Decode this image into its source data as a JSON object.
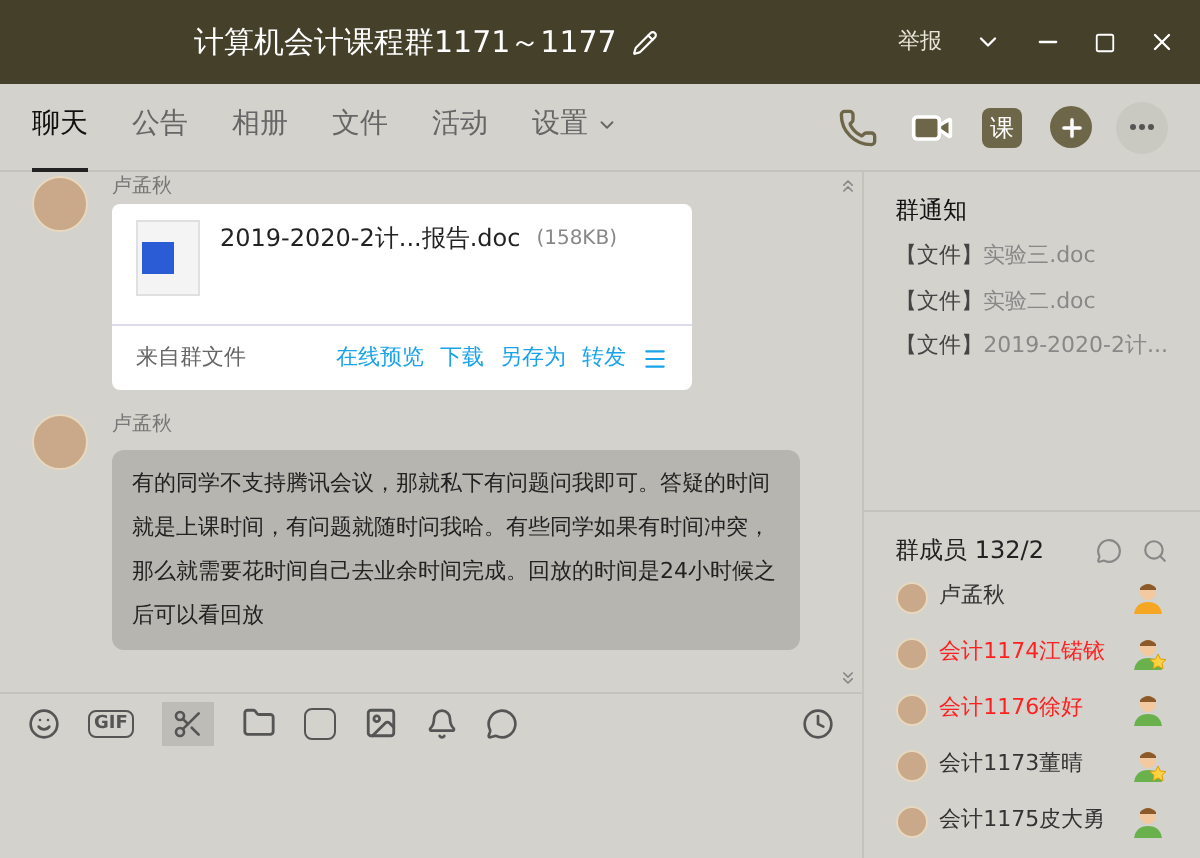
{
  "window": {
    "title": "计算机会计课程群1171～1177",
    "report": "举报",
    "class_button": "课"
  },
  "toolbar": {
    "gif_label": "GIF"
  },
  "tabs": [
    {
      "label": "聊天",
      "selected": true
    },
    {
      "label": "公告",
      "selected": false
    },
    {
      "label": "相册",
      "selected": false
    },
    {
      "label": "文件",
      "selected": false
    },
    {
      "label": "活动",
      "selected": false
    },
    {
      "label": "设置",
      "selected": false
    }
  ],
  "messages": [
    {
      "kind": "file",
      "sender": "卢孟秋",
      "file_name": "2019-2020-2计...报告.doc",
      "file_size": "(158KB)",
      "source": "来自群文件",
      "actions": [
        "在线预览",
        "下载",
        "另存为",
        "转发"
      ]
    },
    {
      "kind": "text",
      "sender": "卢孟秋",
      "text": "有的同学不支持腾讯会议，那就私下有问题问我即可。答疑的时间就是上课时间，有问题就随时问我哈。有些同学如果有时间冲突，那么就需要花时间自己去业余时间完成。回放的时间是24小时候之后可以看回放"
    }
  ],
  "notice": {
    "title": "群通知",
    "items": [
      {
        "tag": "【文件】",
        "name": "实验三.doc"
      },
      {
        "tag": "【文件】",
        "name": "实验二.doc"
      },
      {
        "tag": "【文件】",
        "name": "2019-2020-2计..."
      }
    ]
  },
  "members": {
    "title": "群成员 132/2",
    "items": [
      {
        "name": "卢孟秋",
        "color": "#333333",
        "kind": "owner"
      },
      {
        "name": "会计1174江锘铱",
        "color": "#ff2020",
        "kind": "admin"
      },
      {
        "name": "会计1176徐好",
        "color": "#ff2020",
        "kind": "member"
      },
      {
        "name": "会计1173董晴",
        "color": "#333333",
        "kind": "admin"
      },
      {
        "name": "会计1175皮大勇",
        "color": "#333333",
        "kind": "member"
      }
    ]
  }
}
